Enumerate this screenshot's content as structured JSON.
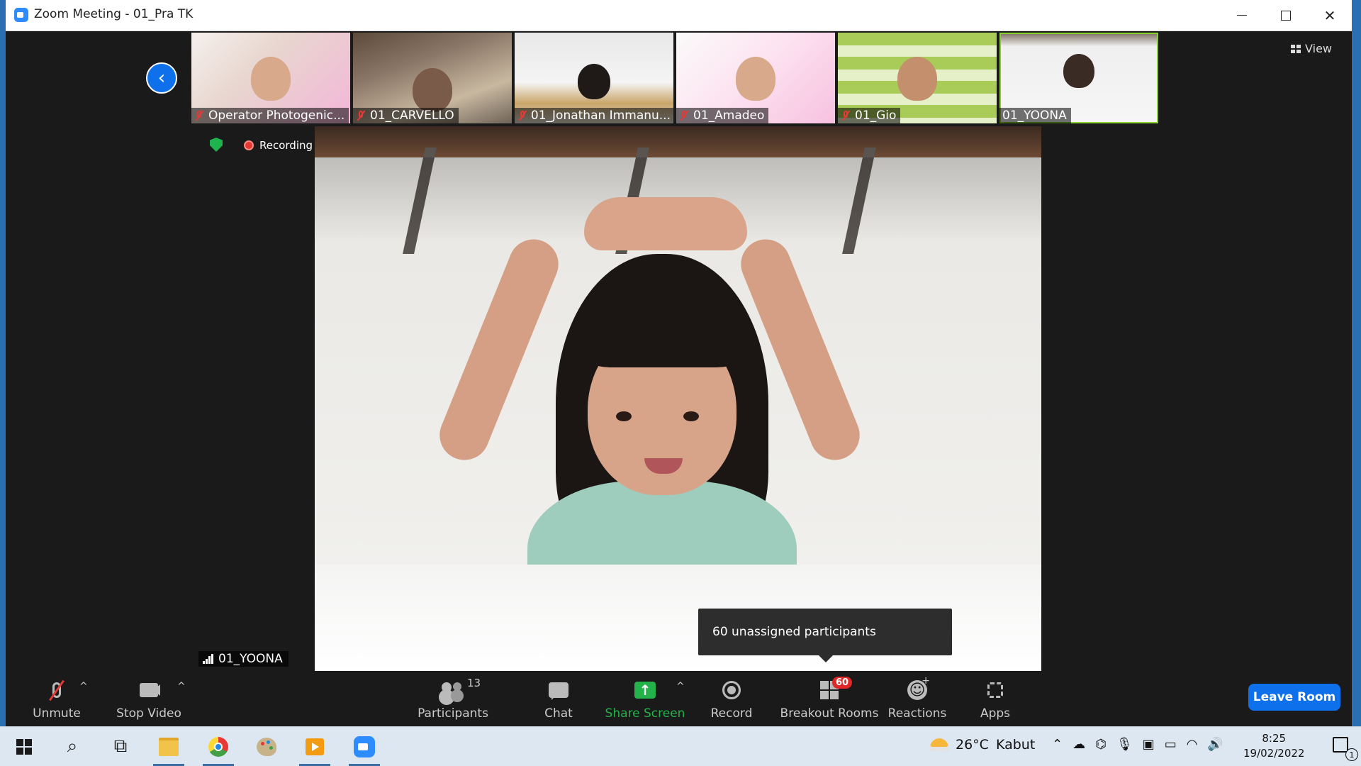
{
  "window": {
    "title": "Zoom Meeting - 01_Pra TK"
  },
  "top_bar": {
    "view_label": "View"
  },
  "thumbnails": [
    {
      "name": "Operator Photogenic...",
      "muted": true
    },
    {
      "name": "01_CARVELLO",
      "muted": true
    },
    {
      "name": "01_Jonathan Immanu...",
      "muted": true
    },
    {
      "name": "01_Amadeo",
      "muted": true
    },
    {
      "name": "01_Gio",
      "muted": true
    },
    {
      "name": "01_YOONA",
      "muted": false,
      "active": true
    }
  ],
  "status": {
    "recording_label": "Recording"
  },
  "active_speaker": {
    "name": "01_YOONA"
  },
  "tooltip": {
    "text": "60 unassigned participants"
  },
  "toolbar": {
    "unmute": "Unmute",
    "stop_video": "Stop Video",
    "participants": "Participants",
    "participants_count": "13",
    "chat": "Chat",
    "share_screen": "Share Screen",
    "record": "Record",
    "breakout_rooms": "Breakout Rooms",
    "breakout_badge": "60",
    "reactions": "Reactions",
    "apps": "Apps",
    "leave_room": "Leave Room",
    "caret": "^"
  },
  "taskbar": {
    "temperature": "26°C",
    "weather": "Kabut",
    "time": "8:25",
    "date": "19/02/2022",
    "notification_count": "1"
  },
  "colors": {
    "accent_blue": "#0e71eb",
    "share_green": "#24b24b",
    "muted_red": "#e53935",
    "active_border": "#8ad130"
  }
}
